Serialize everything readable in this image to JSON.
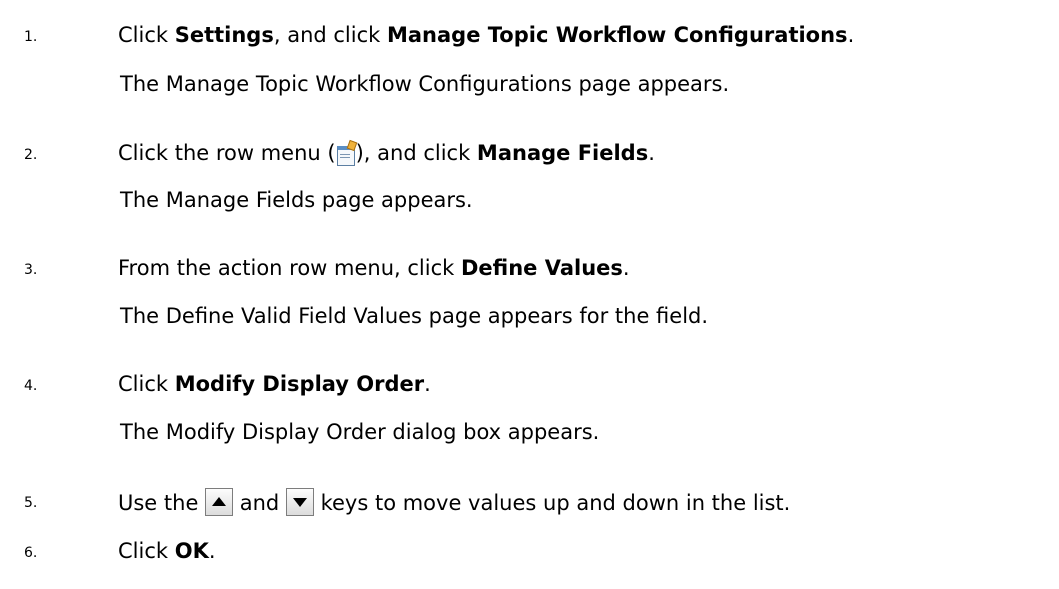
{
  "steps": [
    {
      "num": "1.",
      "parts": [
        "Click ",
        "Settings",
        ", and click ",
        "Manage Topic Workflow Configurations",
        "."
      ],
      "result": "The Manage Topic Workflow Configurations page appears."
    },
    {
      "num": "2.",
      "parts": [
        "Click the row menu (",
        "), and click ",
        "Manage Fields",
        "."
      ],
      "result": "The Manage Fields page appears.",
      "icon": "row-menu-icon"
    },
    {
      "num": "3.",
      "parts": [
        "From the action row menu, click ",
        "Define Values",
        "."
      ],
      "result": "The Define Valid Field Values page appears for the field."
    },
    {
      "num": "4.",
      "parts": [
        "Click ",
        "Modify Display Order",
        "."
      ],
      "result": "The Modify Display Order dialog box appears."
    },
    {
      "num": "5.",
      "parts": [
        "Use the ",
        " and ",
        " keys to move values up and down in the list."
      ],
      "icons": [
        "up-arrow-icon",
        "down-arrow-icon"
      ]
    },
    {
      "num": "6.",
      "parts": [
        "Click ",
        "OK",
        "."
      ]
    }
  ]
}
